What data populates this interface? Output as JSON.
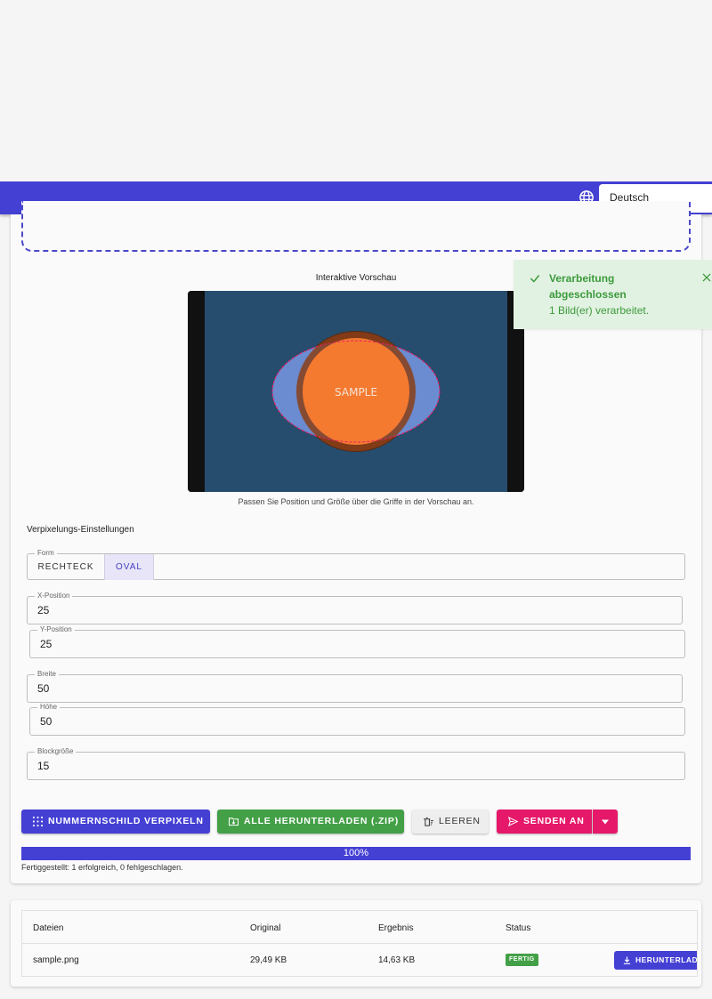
{
  "header": {
    "language": "Deutsch",
    "globe_icon": "globe-icon"
  },
  "toast": {
    "title": "Verarbeitung abgeschlossen",
    "message": "1 Bild(er) verarbeitet."
  },
  "preview": {
    "title": "Interaktive Vorschau",
    "sample_text": "SAMPLE",
    "hint": "Passen Sie Position und Größe über die Griffe in der Vorschau an."
  },
  "settings": {
    "title": "Verpixelungs-Einstellungen",
    "shape_label": "Form",
    "shape_options": [
      "RECHTECK",
      "OVAL"
    ],
    "shape_selected": "OVAL",
    "x_label": "X-Position",
    "x_value": "25",
    "y_label": "Y-Position",
    "y_value": "25",
    "width_label": "Breite",
    "width_value": "50",
    "height_label": "Höhe",
    "height_value": "50",
    "block_label": "Blockgröße",
    "block_value": "15"
  },
  "actions": {
    "pixelate": "NUMMERNSCHILD VERPIXELN",
    "download_all": "ALLE HERUNTERLADEN (.ZIP)",
    "clear": "LEEREN",
    "send_to": "SENDEN AN"
  },
  "progress": {
    "percent_label": "100%",
    "percent": 100,
    "summary": "Fertiggestellt: 1 erfolgreich, 0 fehlgeschlagen."
  },
  "table": {
    "headers": [
      "Dateien",
      "Original",
      "Ergebnis",
      "Status"
    ],
    "rows": [
      {
        "file": "sample.png",
        "original": "29,49 KB",
        "result": "14,63 KB",
        "status": "FERTIG",
        "action": "HERUNTERLADEN"
      }
    ]
  },
  "colors": {
    "primary": "#4440d4",
    "success": "#43a047",
    "accent": "#e91e63",
    "sample_orange": "#f47a30"
  }
}
